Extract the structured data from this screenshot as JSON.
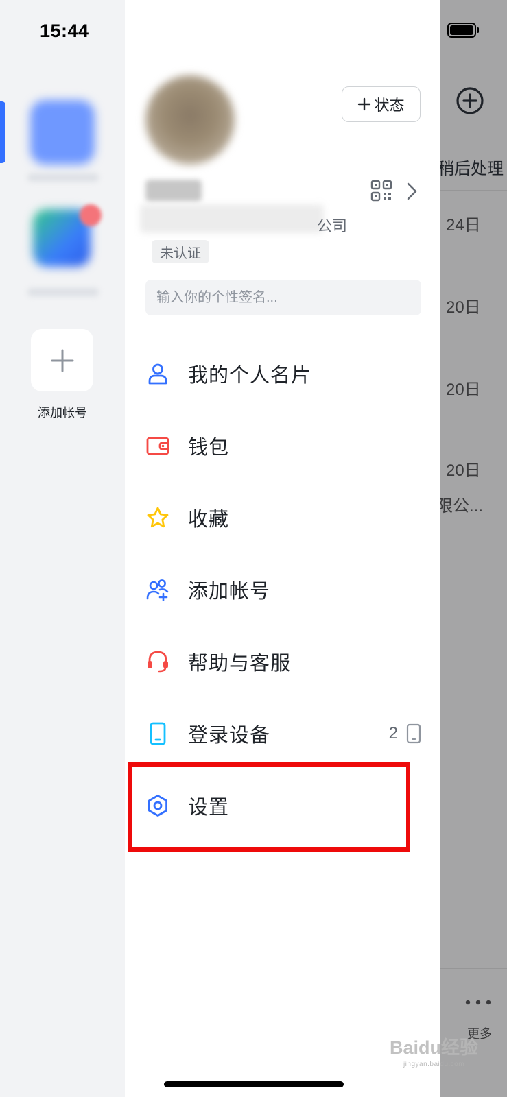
{
  "status_bar": {
    "time": "15:44"
  },
  "rail": {
    "add_account_label": "添加帐号"
  },
  "profile": {
    "status_button": "状态",
    "company_suffix": "公司",
    "verification": "未认证",
    "signature_placeholder": "输入你的个性签名..."
  },
  "menu": {
    "items": [
      {
        "label": "我的个人名片",
        "icon": "user-card-icon",
        "color": "#3370ff"
      },
      {
        "label": "钱包",
        "icon": "wallet-icon",
        "color": "#f54a45"
      },
      {
        "label": "收藏",
        "icon": "star-icon",
        "color": "#ffc60a"
      },
      {
        "label": "添加帐号",
        "icon": "add-user-icon",
        "color": "#3370ff"
      },
      {
        "label": "帮助与客服",
        "icon": "headset-icon",
        "color": "#f54a45"
      },
      {
        "label": "登录设备",
        "icon": "phone-icon",
        "color": "#14c0ff",
        "count": "2"
      },
      {
        "label": "设置",
        "icon": "gear-icon",
        "color": "#3370ff"
      }
    ]
  },
  "main": {
    "tab_label": "稍后处理",
    "dates": [
      "24日",
      "20日",
      "20日",
      "20日"
    ],
    "snippet": "限公...",
    "more_label": "更多"
  },
  "watermark": {
    "brand": "Baidu经验",
    "url": "jingyan.baidu.com"
  },
  "colors": {
    "accent": "#3370ff",
    "highlight": "#ee0a0a"
  }
}
